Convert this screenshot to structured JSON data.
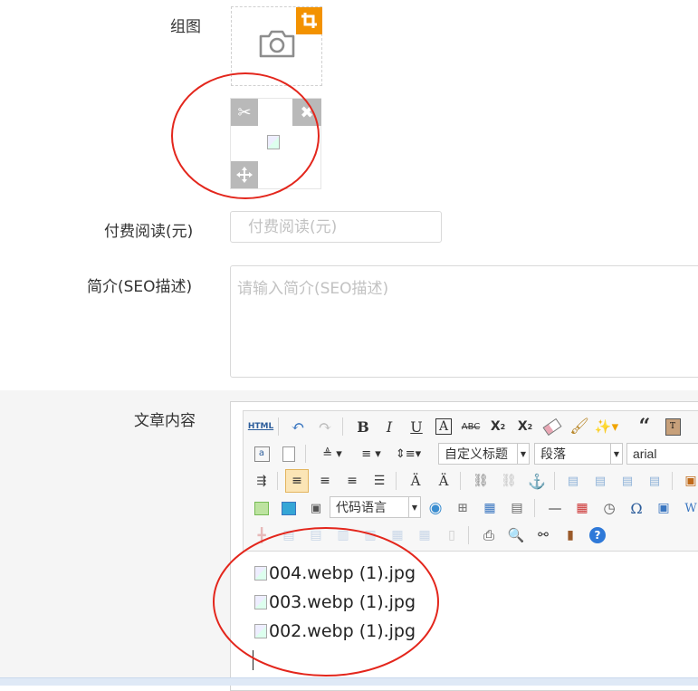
{
  "form": {
    "gallery_label": "组图",
    "paid_label": "付费阅读(元)",
    "paid_placeholder": "付费阅读(元)",
    "intro_label": "简介(SEO描述)",
    "intro_placeholder": "请输入简介(SEO描述)",
    "content_label": "文章内容"
  },
  "editor": {
    "row1": [
      "HTML",
      "undo",
      "redo",
      "bold",
      "italic",
      "underline",
      "font-border",
      "strikethrough",
      "superscript",
      "subscript",
      "eraser",
      "format-brush",
      "magic-wand",
      "blockquote",
      "paste-text"
    ],
    "heading_select": "自定义标题",
    "paragraph_select": "段落",
    "font_select": "arial",
    "code_select": "代码语言",
    "content_images": [
      "004.webp (1).jpg",
      "003.webp (1).jpg",
      "002.webp (1).jpg"
    ]
  },
  "colors": {
    "accent_orange": "#f39200",
    "annotation_red": "#e3261c",
    "overlay_gray": "#b9b9b9"
  }
}
